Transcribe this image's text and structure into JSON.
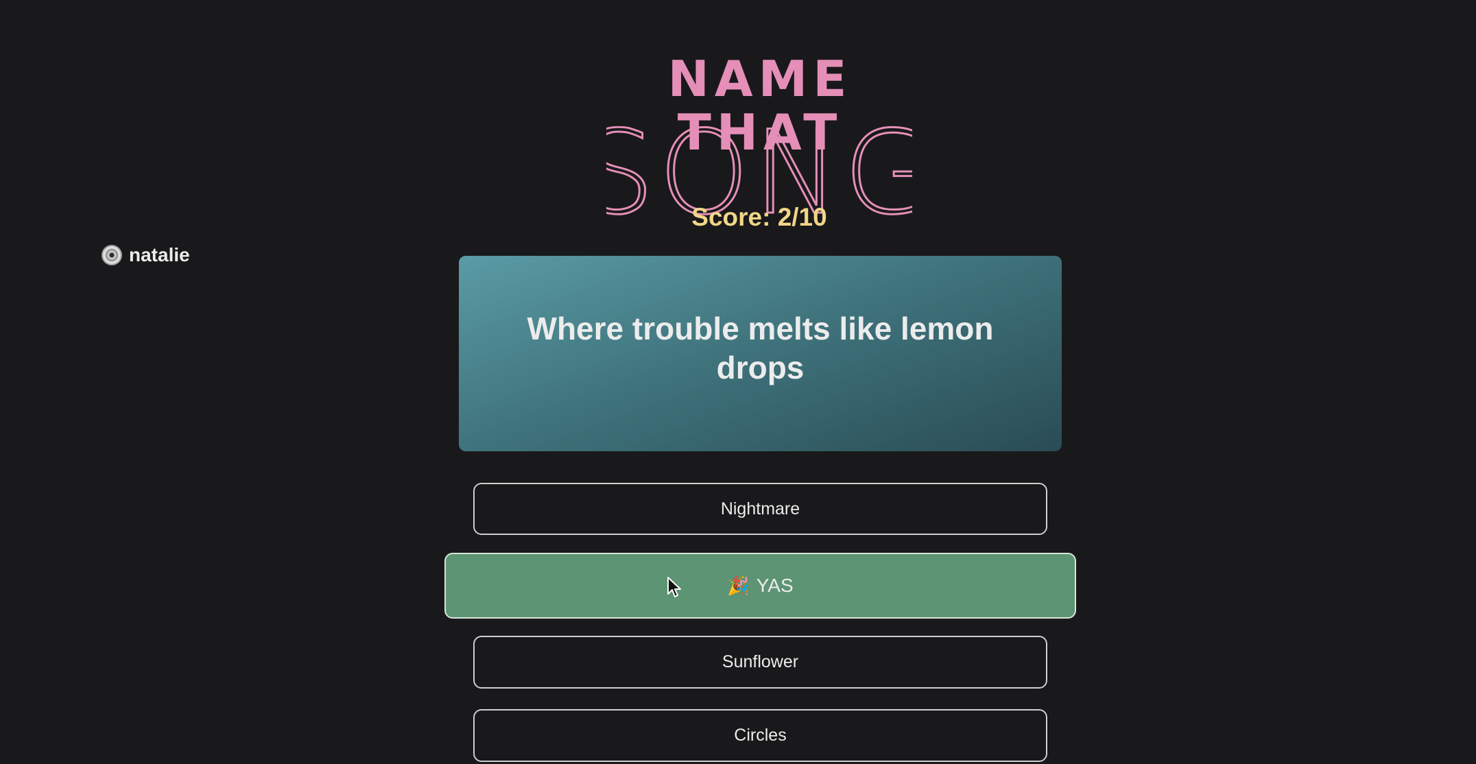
{
  "logo": {
    "line1": "NAME THAT",
    "line2": "SONG",
    "color": "#e58fb8"
  },
  "score": {
    "text": "Score: 2/10",
    "color": "#f1d688"
  },
  "user": {
    "icon": "cd-icon",
    "name": "natalie"
  },
  "question": {
    "text": "Where trouble melts like lemon drops"
  },
  "answers": [
    {
      "label": "Nightmare",
      "state": "default"
    },
    {
      "label": "YAS",
      "state": "correct",
      "icon": "party-popper-icon",
      "icon_glyph": "🎉",
      "color": "#5d9473"
    },
    {
      "label": "Sunflower",
      "state": "default"
    },
    {
      "label": "Circles",
      "state": "default"
    }
  ]
}
